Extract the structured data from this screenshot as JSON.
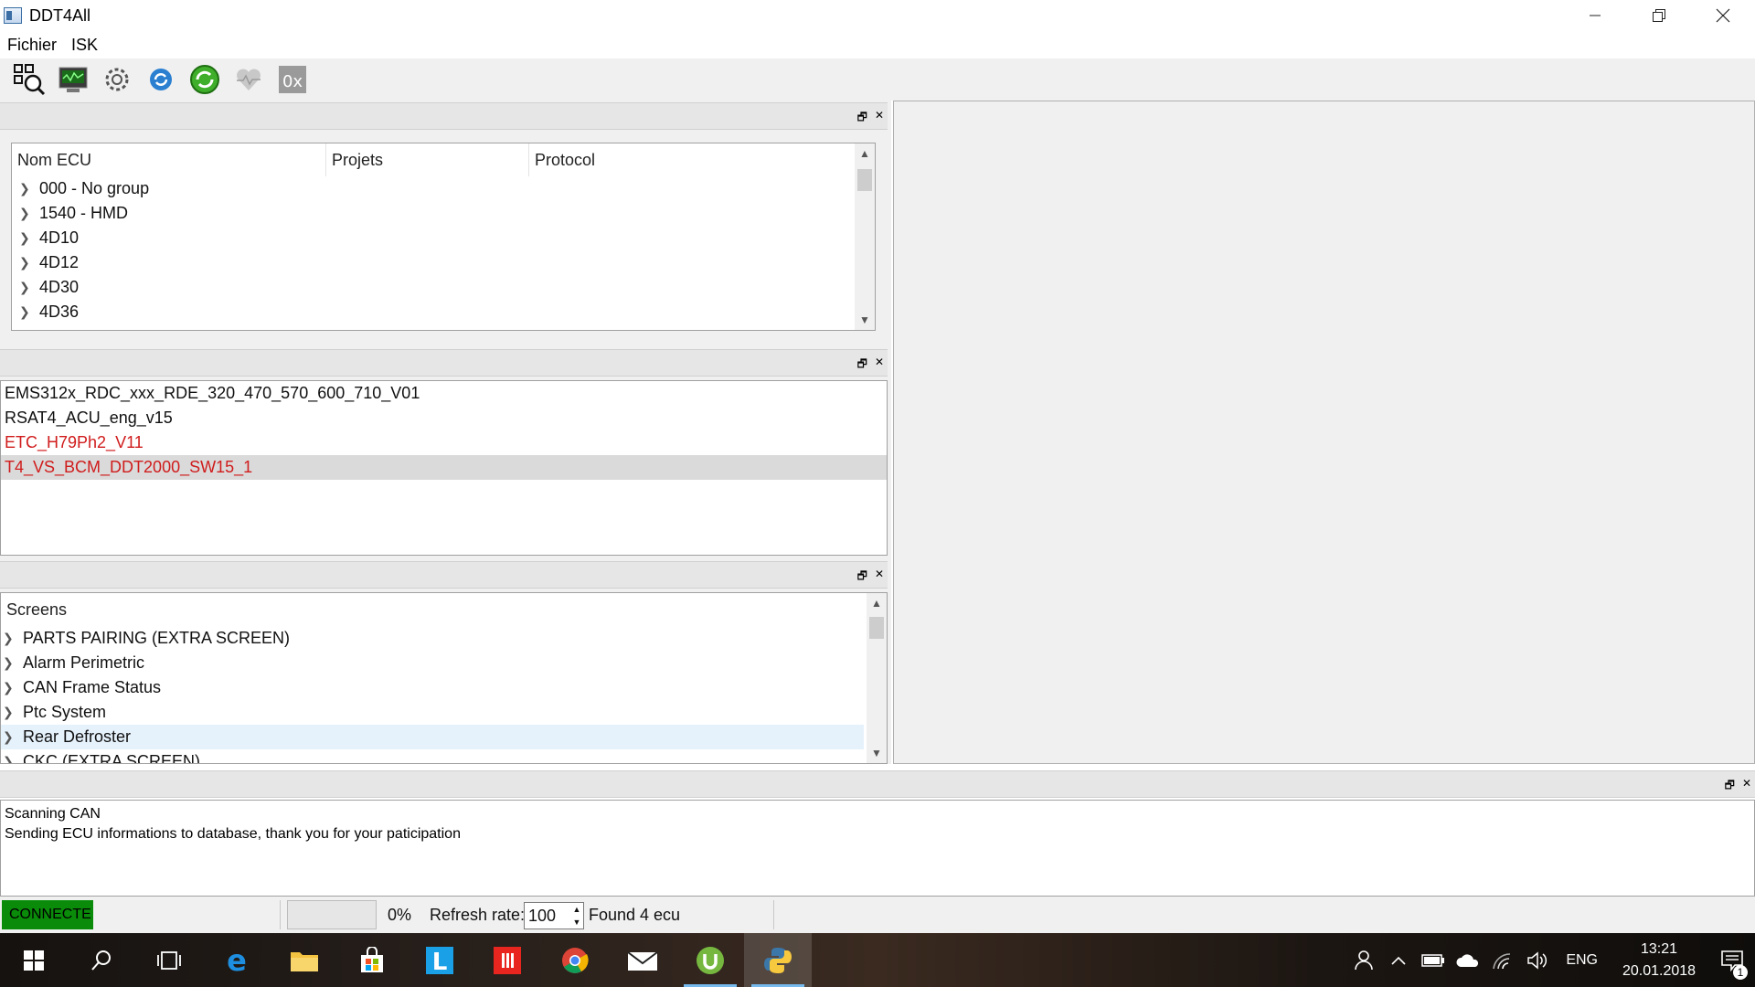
{
  "window": {
    "title": "DDT4All"
  },
  "menu": [
    "Fichier",
    "ISK"
  ],
  "ecu_tree": {
    "columns": [
      "Nom ECU",
      "Projets",
      "Protocol"
    ],
    "items": [
      "000 - No group",
      "1540 - HMD",
      "4D10",
      "4D12",
      "4D30",
      "4D36"
    ]
  },
  "ecu_list": {
    "items": [
      {
        "label": "EMS312x_RDC_xxx_RDE_320_470_570_600_710_V01",
        "color": "#111111"
      },
      {
        "label": "RSAT4_ACU_eng_v15",
        "color": "#111111"
      },
      {
        "label": "ETC_H79Ph2_V11",
        "color": "#d01c1c"
      },
      {
        "label": "T4_VS_BCM_DDT2000_SW15_1",
        "color": "#d01c1c"
      }
    ]
  },
  "screens_tree": {
    "header": "Screens",
    "items": [
      "PARTS PAIRING (EXTRA SCREEN)",
      "Alarm Perimetric",
      "CAN Frame Status",
      "Ptc System",
      "Rear Defroster",
      "CKC (EXTRA SCREEN)"
    ]
  },
  "log": {
    "lines": [
      "Scanning CAN",
      "Sending ECU informations to database, thank you for your paticipation"
    ]
  },
  "status": {
    "connection": "CONNECTE",
    "connection_color": "#0a8c0a",
    "progress": "0%",
    "refresh_label": "Refresh rate:",
    "refresh_value": "100",
    "found": "Found 4 ecu"
  },
  "taskbar": {
    "lang": "ENG",
    "time": "13:21",
    "date": "20.01.2018",
    "notifications": "1"
  }
}
